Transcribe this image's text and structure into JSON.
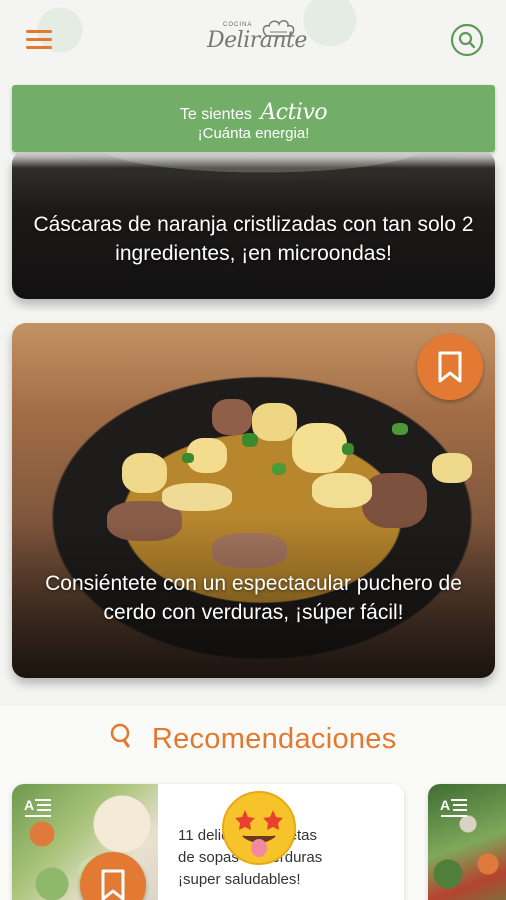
{
  "app": {
    "logo_small": "COCINA",
    "logo_main": "Delirante"
  },
  "mood": {
    "prefix": "Te sientes",
    "state": "Activo",
    "message": "¡Cuánta energia!"
  },
  "recipes": [
    {
      "title": "Cáscaras de naranja cristlizadas con tan solo 2 ingredientes, ¡en microondas!"
    },
    {
      "title": "Consiéntete con un espectacular puchero de cerdo con verduras, ¡súper fácil!",
      "bookmark_icon": "bookmark-icon"
    }
  ],
  "recommendations": {
    "header": "Recomendaciones",
    "items": [
      {
        "title_line1": "11 deliciosas recetas",
        "title_line2": "de sopas de verduras",
        "title_line3": "¡super saludables!",
        "icon": "article-icon"
      },
      {
        "icon": "article-icon"
      }
    ]
  },
  "colors": {
    "accent": "#e2792f",
    "mood_green": "#72ae68",
    "bookmark": "#e37a34"
  },
  "icons": [
    "hamburger-menu-icon",
    "search-icon",
    "bookmark-icon",
    "article-icon",
    "lightbulb-icon",
    "star-eyes-emoji"
  ]
}
